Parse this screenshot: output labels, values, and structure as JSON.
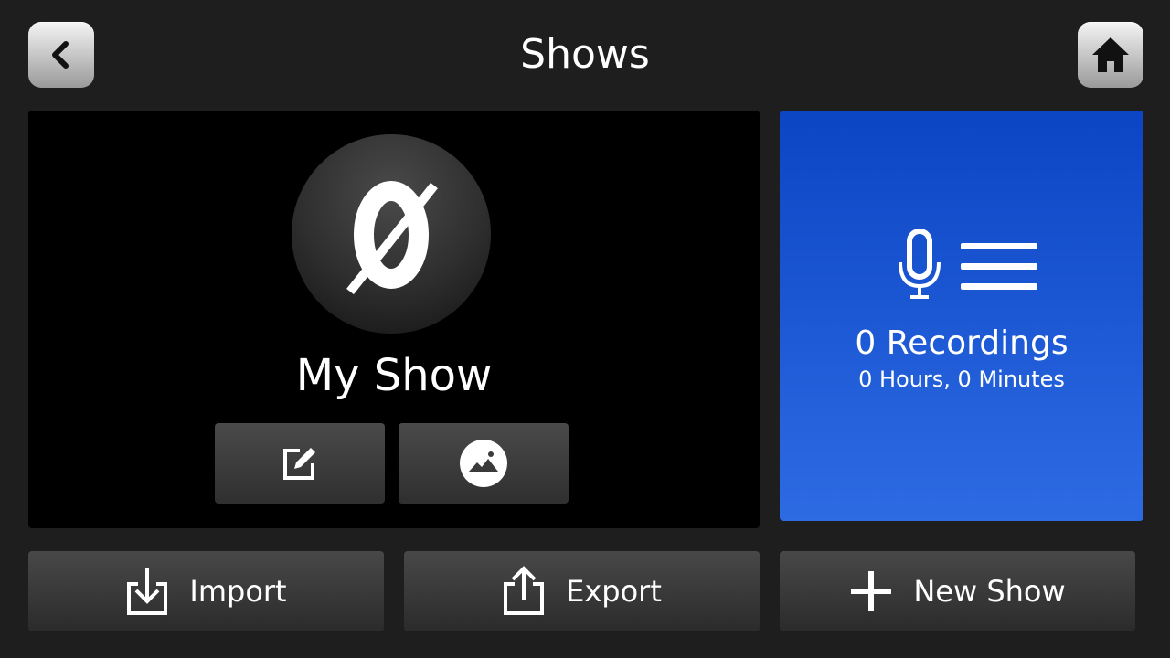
{
  "header": {
    "title": "Shows",
    "back_icon": "chevron-left-icon",
    "home_icon": "home-icon"
  },
  "show": {
    "name": "My Show",
    "logo_icon": "slashed-zero-icon",
    "edit_icon": "edit-icon",
    "image_icon": "image-icon"
  },
  "recordings": {
    "count_text": "0 Recordings",
    "duration_text": "0 Hours, 0 Minutes",
    "icon": "microphone-list-icon",
    "card_color_top": "#0c45c4",
    "card_color_bottom": "#2d6be3"
  },
  "actions": {
    "import_label": "Import",
    "export_label": "Export",
    "new_show_label": "New Show"
  }
}
